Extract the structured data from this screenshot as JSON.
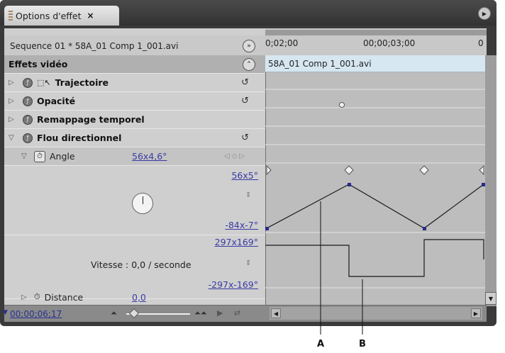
{
  "tab": {
    "label": "Options d'effet",
    "close": "×"
  },
  "sequence": {
    "label": "Sequence 01 * 58A_01 Comp 1_001.avi",
    "go_label": "»"
  },
  "effects_header": {
    "title": "Effets vidéo",
    "collapse": "⌃"
  },
  "effects": [
    {
      "name": "Trajectoire"
    },
    {
      "name": "Opacité"
    },
    {
      "name": "Remappage temporel"
    },
    {
      "name": "Flou directionnel"
    }
  ],
  "angle": {
    "name": "Angle",
    "value": "56x4,6°",
    "max": "56x5°",
    "min": "-84x-7°"
  },
  "velocity": {
    "max": "297x169°",
    "label": "Vitesse : 0,0 / seconde",
    "min": "-297x-169°"
  },
  "distance": {
    "name": "Distance",
    "value": "0,0"
  },
  "timeline": {
    "ruler_labels": [
      "0;02;00",
      "00;00;03;00",
      "0"
    ],
    "clip_name": "58A_01 Comp 1_001.avi"
  },
  "bottom": {
    "timecode": "00;00;06;17"
  },
  "callouts": {
    "a": "A",
    "b": "B"
  },
  "colors": {
    "link_blue": "#3a3aa5",
    "clip_bg": "#d6e7f1",
    "panel_dark": "#3a3a3a"
  }
}
